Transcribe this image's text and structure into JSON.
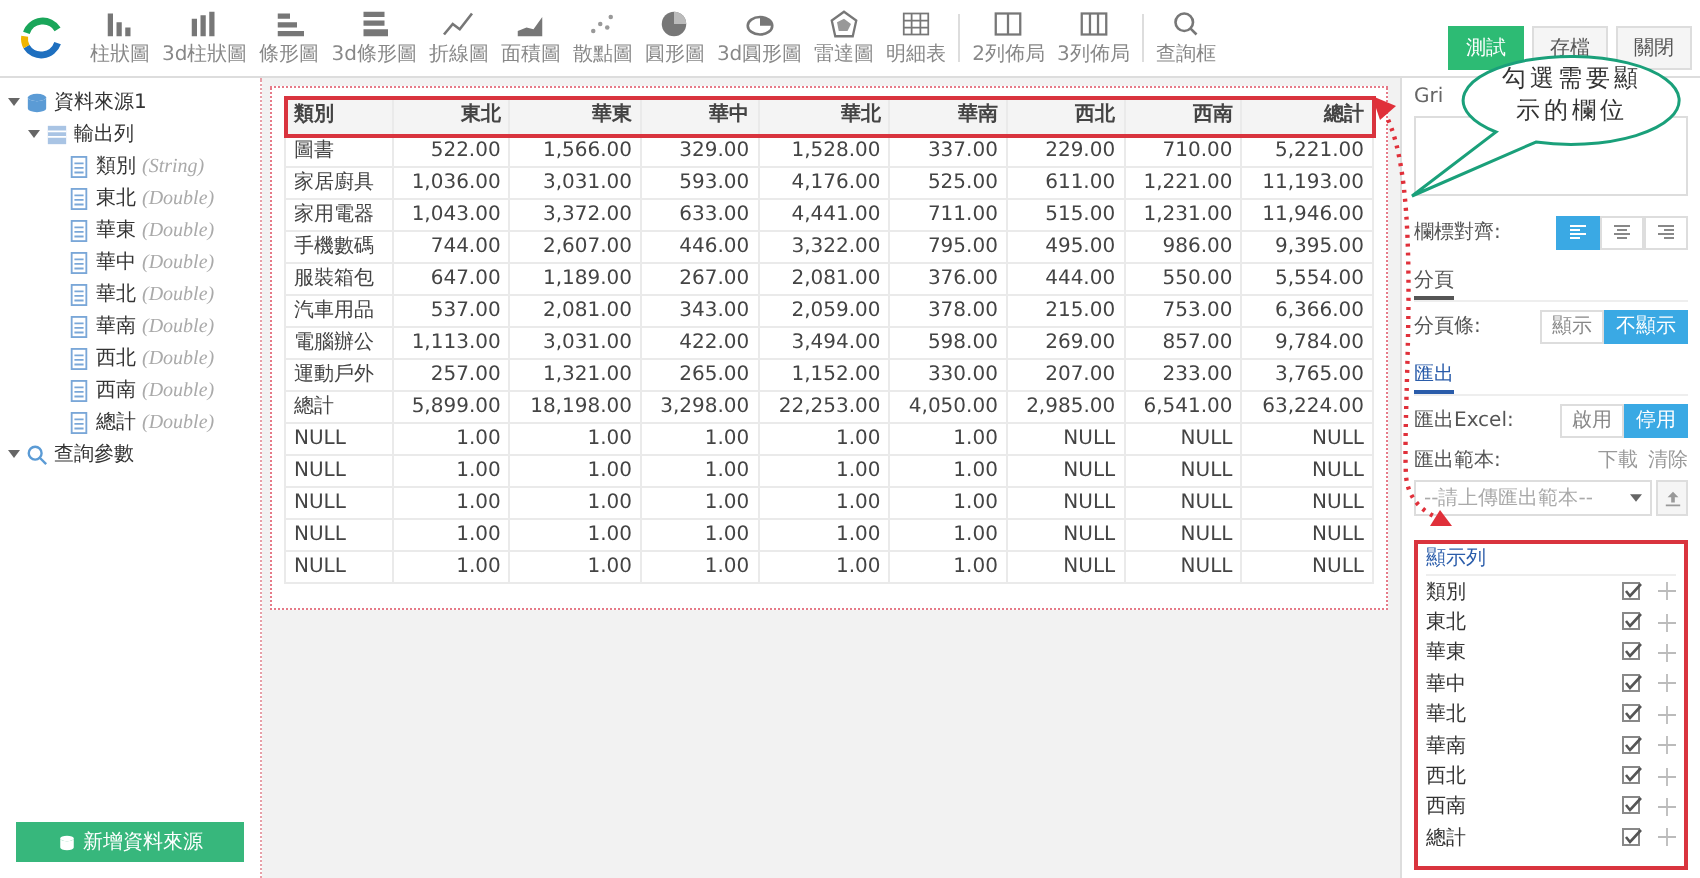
{
  "toolbar": {
    "items": [
      {
        "label": "柱狀圖",
        "kind": "bar"
      },
      {
        "label": "3d柱狀圖",
        "kind": "bar3d"
      },
      {
        "label": "條形圖",
        "kind": "hbar"
      },
      {
        "label": "3d條形圖",
        "kind": "hbar3d"
      },
      {
        "label": "折線圖",
        "kind": "line"
      },
      {
        "label": "面積圖",
        "kind": "area"
      },
      {
        "label": "散點圖",
        "kind": "scatter"
      },
      {
        "label": "圓形圖",
        "kind": "pie"
      },
      {
        "label": "3d圓形圖",
        "kind": "pie3d"
      },
      {
        "label": "雷達圖",
        "kind": "radar"
      },
      {
        "label": "明細表",
        "kind": "grid"
      },
      {
        "label": "2列佈局",
        "kind": "col2"
      },
      {
        "label": "3列佈局",
        "kind": "col3"
      },
      {
        "label": "查詢框",
        "kind": "search"
      }
    ]
  },
  "actions": [
    {
      "label": "測試",
      "primary": true
    },
    {
      "label": "存檔",
      "primary": false
    },
    {
      "label": "關閉",
      "primary": false
    }
  ],
  "tree": [
    {
      "label": "資料來源1",
      "kind": "db",
      "expanded": true,
      "children": [
        {
          "label": "輸出列",
          "kind": "table",
          "expanded": true,
          "children": [
            {
              "label": "類別",
              "type": "(String)"
            },
            {
              "label": "東北",
              "type": "(Double)"
            },
            {
              "label": "華東",
              "type": "(Double)"
            },
            {
              "label": "華中",
              "type": "(Double)"
            },
            {
              "label": "華北",
              "type": "(Double)"
            },
            {
              "label": "華南",
              "type": "(Double)"
            },
            {
              "label": "西北",
              "type": "(Double)"
            },
            {
              "label": "西南",
              "type": "(Double)"
            },
            {
              "label": "總計",
              "type": "(Double)"
            }
          ]
        }
      ]
    },
    {
      "label": "查詢參數",
      "kind": "search",
      "expanded": true
    }
  ],
  "add_source_button": "新增資料來源",
  "table": {
    "columns": [
      "類別",
      "東北",
      "華東",
      "華中",
      "華北",
      "華南",
      "西北",
      "西南",
      "總計"
    ],
    "rows": [
      [
        "圖書",
        "522.00",
        "1,566.00",
        "329.00",
        "1,528.00",
        "337.00",
        "229.00",
        "710.00",
        "5,221.00"
      ],
      [
        "家居廚具",
        "1,036.00",
        "3,031.00",
        "593.00",
        "4,176.00",
        "525.00",
        "611.00",
        "1,221.00",
        "11,193.00"
      ],
      [
        "家用電器",
        "1,043.00",
        "3,372.00",
        "633.00",
        "4,441.00",
        "711.00",
        "515.00",
        "1,231.00",
        "11,946.00"
      ],
      [
        "手機數碼",
        "744.00",
        "2,607.00",
        "446.00",
        "3,322.00",
        "795.00",
        "495.00",
        "986.00",
        "9,395.00"
      ],
      [
        "服裝箱包",
        "647.00",
        "1,189.00",
        "267.00",
        "2,081.00",
        "376.00",
        "444.00",
        "550.00",
        "5,554.00"
      ],
      [
        "汽車用品",
        "537.00",
        "2,081.00",
        "343.00",
        "2,059.00",
        "378.00",
        "215.00",
        "753.00",
        "6,366.00"
      ],
      [
        "電腦辦公",
        "1,113.00",
        "3,031.00",
        "422.00",
        "3,494.00",
        "598.00",
        "269.00",
        "857.00",
        "9,784.00"
      ],
      [
        "運動戶外",
        "257.00",
        "1,321.00",
        "265.00",
        "1,152.00",
        "330.00",
        "207.00",
        "233.00",
        "3,765.00"
      ],
      [
        "總計",
        "5,899.00",
        "18,198.00",
        "3,298.00",
        "22,253.00",
        "4,050.00",
        "2,985.00",
        "6,541.00",
        "63,224.00"
      ],
      [
        "NULL",
        "1.00",
        "1.00",
        "1.00",
        "1.00",
        "1.00",
        "NULL",
        "NULL",
        "NULL"
      ],
      [
        "NULL",
        "1.00",
        "1.00",
        "1.00",
        "1.00",
        "1.00",
        "NULL",
        "NULL",
        "NULL"
      ],
      [
        "NULL",
        "1.00",
        "1.00",
        "1.00",
        "1.00",
        "1.00",
        "NULL",
        "NULL",
        "NULL"
      ],
      [
        "NULL",
        "1.00",
        "1.00",
        "1.00",
        "1.00",
        "1.00",
        "NULL",
        "NULL",
        "NULL"
      ],
      [
        "NULL",
        "1.00",
        "1.00",
        "1.00",
        "1.00",
        "1.00",
        "NULL",
        "NULL",
        "NULL"
      ]
    ]
  },
  "panel": {
    "grid_label": "Gri",
    "header_align": {
      "label": "欄標對齊:",
      "options": [
        {
          "kind": "left",
          "selected": true
        },
        {
          "kind": "center",
          "selected": false
        },
        {
          "kind": "right",
          "selected": false
        }
      ]
    },
    "paging_title": "分頁",
    "paging": {
      "label": "分頁條:",
      "options": [
        {
          "label": "顯示",
          "selected": false
        },
        {
          "label": "不顯示",
          "selected": true
        }
      ]
    },
    "export_title": "匯出",
    "export_excel": {
      "label": "匯出Excel:",
      "options": [
        {
          "label": "啟用",
          "selected": false
        },
        {
          "label": "停用",
          "selected": true
        }
      ]
    },
    "template": {
      "label": "匯出範本:",
      "links": [
        "下載",
        "清除"
      ],
      "placeholder": "--請上傳匯出範本--"
    },
    "columns_title": "顯示列",
    "columns_list": [
      {
        "label": "類別",
        "checked": true
      },
      {
        "label": "東北",
        "checked": true
      },
      {
        "label": "華東",
        "checked": true
      },
      {
        "label": "華中",
        "checked": true
      },
      {
        "label": "華北",
        "checked": true
      },
      {
        "label": "華南",
        "checked": true
      },
      {
        "label": "西北",
        "checked": true
      },
      {
        "label": "西南",
        "checked": true
      },
      {
        "label": "總計",
        "checked": true
      }
    ]
  },
  "callout": [
    "勾選需要顯",
    "示的欄位"
  ]
}
